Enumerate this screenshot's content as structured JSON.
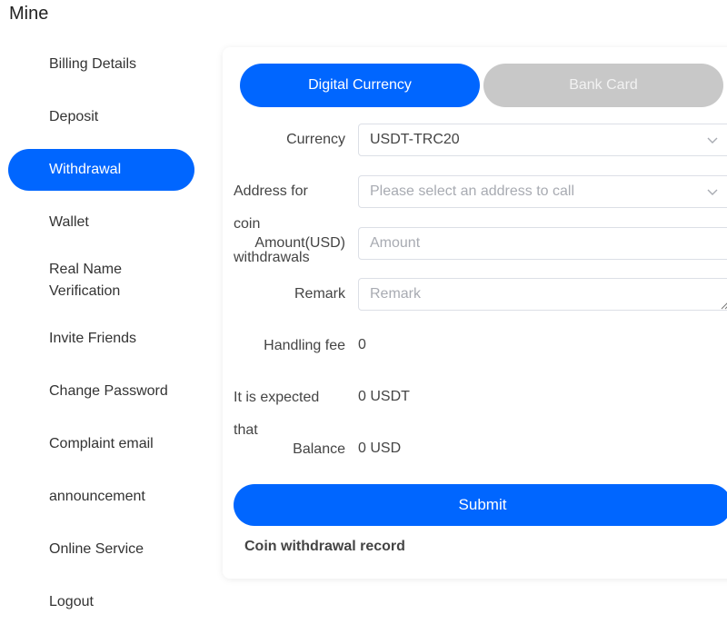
{
  "page": {
    "title": "Mine"
  },
  "sidebar": {
    "items": [
      {
        "label": "Billing Details"
      },
      {
        "label": "Deposit"
      },
      {
        "label": "Withdrawal",
        "active": true
      },
      {
        "label": "Wallet"
      },
      {
        "label": "Real Name Verification"
      },
      {
        "label": "Invite Friends"
      },
      {
        "label": "Change Password"
      },
      {
        "label": "Complaint email"
      },
      {
        "label": "announcement"
      },
      {
        "label": "Online Service"
      },
      {
        "label": "Logout"
      }
    ]
  },
  "tabs": [
    {
      "label": "Digital Currency",
      "active": true
    },
    {
      "label": "Bank Card",
      "active": false
    }
  ],
  "form": {
    "currency_label": "Currency",
    "currency_value": "USDT-TRC20",
    "address_label_1": "Address for",
    "address_label_2": "coin",
    "address_label_3": "withdrawals",
    "address_placeholder": "Please select an address to call",
    "amount_label": "Amount(USD)",
    "amount_placeholder": "Amount",
    "remark_label": "Remark",
    "remark_placeholder": "Remark",
    "fee_label": "Handling fee",
    "fee_value": "0",
    "expected_label_1": "It is expected",
    "expected_label_2": "that",
    "expected_value": "0 USDT",
    "balance_label": "Balance",
    "balance_value": "0 USD"
  },
  "actions": {
    "submit_label": "Submit",
    "record_label": "Coin withdrawal record"
  },
  "colors": {
    "accent": "#0066ff",
    "inactive_tab": "#c8c8c8"
  }
}
